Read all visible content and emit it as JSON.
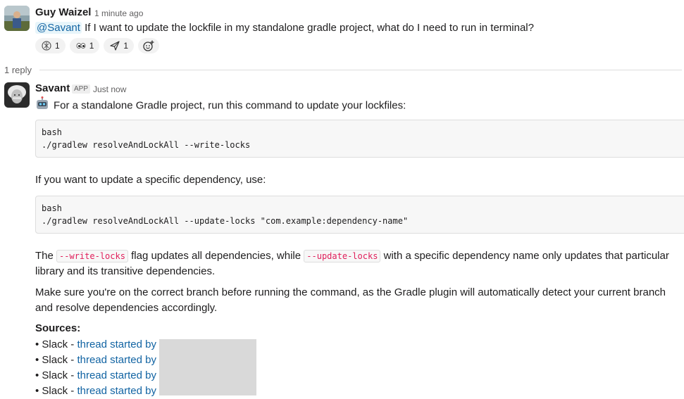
{
  "message1": {
    "author": "Guy Waizel",
    "time": "1 minute ago",
    "mention": "@Savant",
    "text": " If I want to update the lockfile in my standalone gradle project, what do I need to run in terminal?",
    "reactions": [
      {
        "icon": "openai-icon",
        "count": "1"
      },
      {
        "icon": "eyes-icon",
        "count": "1"
      },
      {
        "icon": "paper-plane-icon",
        "count": "1"
      }
    ]
  },
  "thread": {
    "reply_count": "1 reply"
  },
  "message2": {
    "author": "Savant",
    "badge": "APP",
    "time": "Just now",
    "intro": "For a standalone Gradle project, run this command to update your lockfiles:",
    "code1_lang": "bash",
    "code1": "./gradlew resolveAndLockAll --write-locks",
    "specific": "If you want to update a specific dependency, use:",
    "code2_lang": "bash",
    "code2": "./gradlew resolveAndLockAll --update-locks \"com.example:dependency-name\"",
    "para1_a": "The ",
    "para1_code1": "--write-locks",
    "para1_b": " flag updates all dependencies, while ",
    "para1_code2": "--update-locks",
    "para1_c": " with a specific dependency name only updates that particular library and its transitive dependencies.",
    "para2": "Make sure you're on the correct branch before running the command, as the Gradle plugin will automatically detect your current branch and resolve dependencies accordingly.",
    "sources_title": "Sources:",
    "sources": [
      {
        "prefix": "• Slack - ",
        "link": "thread started by"
      },
      {
        "prefix": "• Slack - ",
        "link": "thread started by"
      },
      {
        "prefix": "• Slack - ",
        "link": "thread started by"
      },
      {
        "prefix": "• Slack - ",
        "link": "thread started by"
      }
    ]
  }
}
